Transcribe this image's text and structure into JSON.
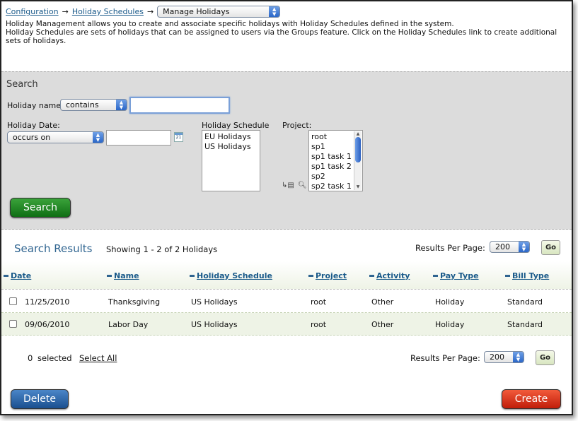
{
  "breadcrumb": {
    "configuration": "Configuration",
    "holiday_schedules": "Holiday Schedules",
    "arrow": "→",
    "current_select": "Manage Holidays"
  },
  "description": {
    "line1": "Holiday Management allows you to create and associate specific holidays with Holiday Schedules defined in the system.",
    "line2": "Holiday Schedules are sets of holidays that can be assigned to users via the Groups feature. Click on the Holiday Schedules link to create additional sets of holidays."
  },
  "search": {
    "title": "Search",
    "holiday_name_label": "Holiday name",
    "holiday_name_operator": "contains",
    "holiday_name_value": "",
    "holiday_date_label": "Holiday Date:",
    "holiday_date_operator": "occurs on",
    "holiday_date_value": "",
    "calendar_icon_text": "21",
    "holiday_schedule_label": "Holiday Schedule",
    "holiday_schedule_options": [
      "EU Holidays",
      "US Holidays"
    ],
    "project_label": "Project:",
    "project_options": [
      "root",
      "sp1",
      "sp1 task 1",
      "sp1 task 2",
      "sp2",
      "sp2 task 1"
    ],
    "search_button": "Search"
  },
  "results": {
    "title": "Search Results",
    "showing": "Showing 1 - 2 of 2 Holidays",
    "results_per_page_label": "Results Per Page:",
    "results_per_page_value": "200",
    "go_label": "Go",
    "columns": [
      "Date",
      "Name",
      "Holiday Schedule",
      "Project",
      "Activity",
      "Pay Type",
      "Bill Type"
    ],
    "rows": [
      {
        "date": "11/25/2010",
        "name": "Thanksgiving",
        "schedule": "US Holidays",
        "project": "root",
        "activity": "Other",
        "pay_type": "Holiday",
        "bill_type": "Standard"
      },
      {
        "date": "09/06/2010",
        "name": "Labor Day",
        "schedule": "US Holidays",
        "project": "root",
        "activity": "Other",
        "pay_type": "Holiday",
        "bill_type": "Standard"
      }
    ]
  },
  "footer": {
    "selected_count": "0",
    "selected_label": "selected",
    "select_all": "Select All",
    "results_per_page_label": "Results Per Page:",
    "results_per_page_value": "200",
    "go_label": "Go",
    "delete_button": "Delete",
    "create_button": "Create"
  },
  "colors": {
    "link": "#1a5a8a",
    "search_panel_bg": "#dcdcdc",
    "search_button": "#1f8a23",
    "delete_button": "#2a64a8",
    "create_button": "#e0391e",
    "results_title": "#2f6490",
    "alt_row": "#eef3e6"
  }
}
